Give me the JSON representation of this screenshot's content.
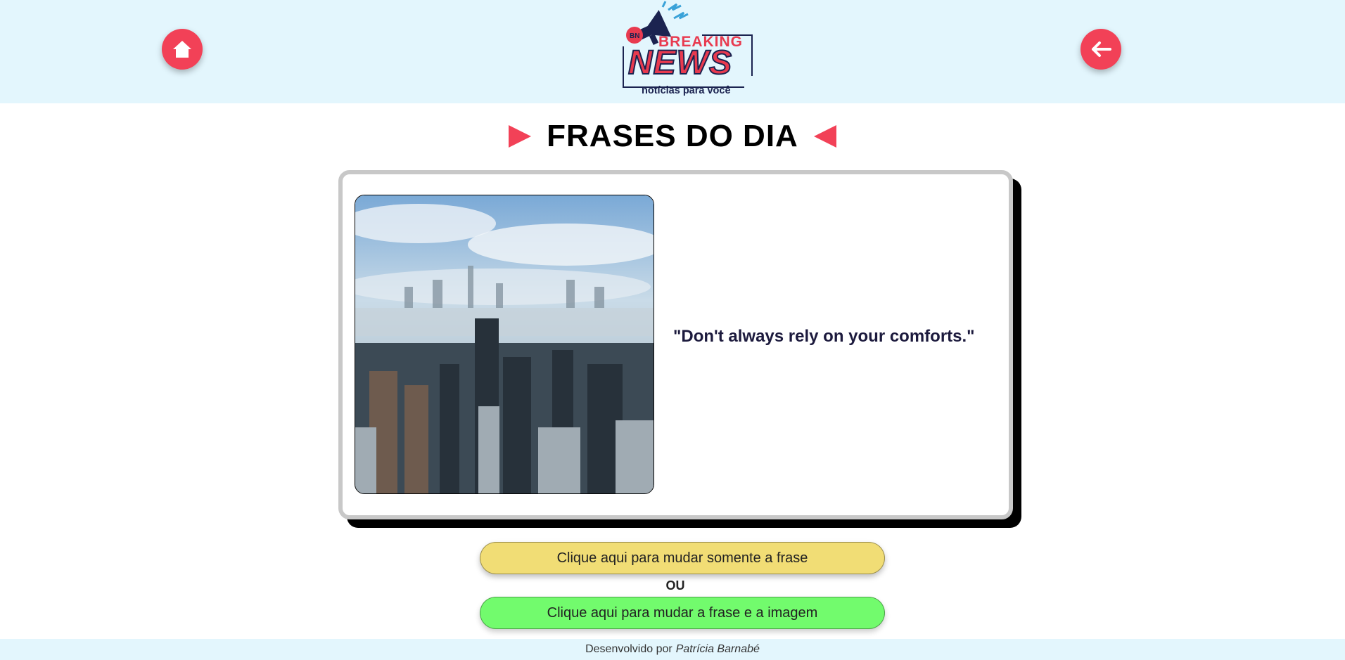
{
  "header": {
    "home_icon": "home-icon",
    "back_icon": "arrow-left-icon",
    "logo": {
      "badge": "BN",
      "line1": "BREAKING",
      "line2": "NEWS",
      "tagline": "notícias para você"
    },
    "colors": {
      "background": "#e3f6fd",
      "accent": "#f24157",
      "navy": "#1b2350"
    }
  },
  "main": {
    "title": "FRASES DO DIA",
    "quote": "\"Don't always rely on your comforts.\"",
    "image": {
      "subject": "foggy city skyline"
    }
  },
  "actions": {
    "change_phrase_label": "Clique aqui para mudar somente a frase",
    "or_label": "OU",
    "change_both_label": "Clique aqui para mudar a frase e a imagem",
    "colors": {
      "phrase_button": "#f1dd75",
      "both_button": "#72fb6d"
    }
  },
  "footer": {
    "prefix": "Desenvolvido por",
    "author": "Patrícia Barnabé"
  }
}
